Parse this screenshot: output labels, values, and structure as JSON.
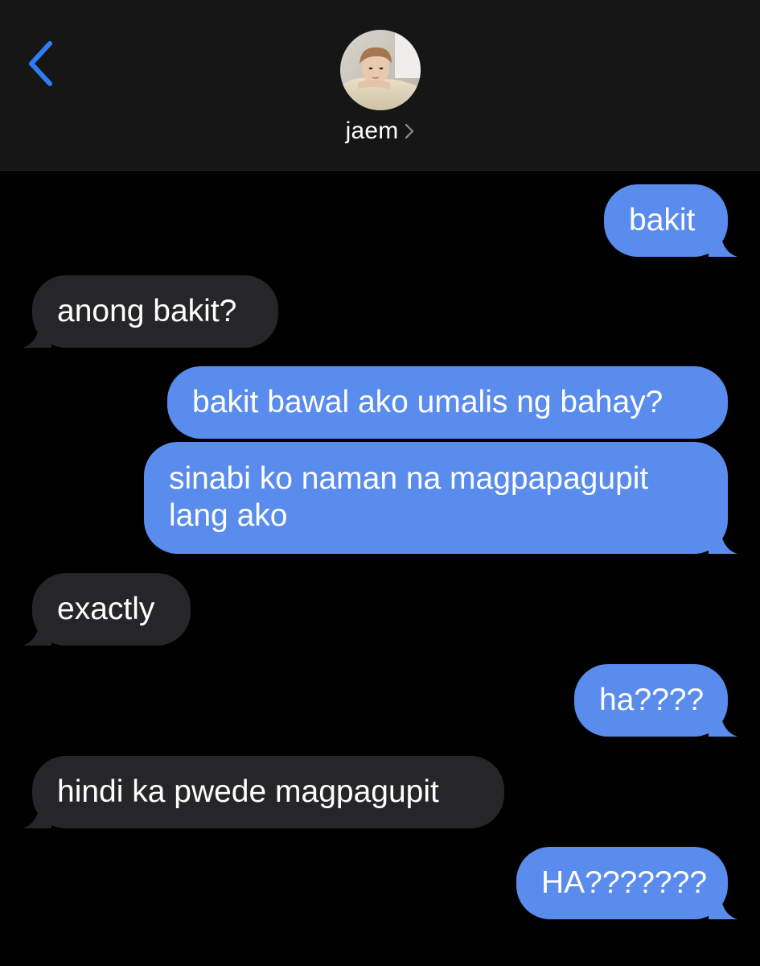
{
  "header": {
    "back_label": "Back",
    "contact_name": "jaem",
    "colors": {
      "accent": "#2f7cf6",
      "header_bg": "#161616"
    }
  },
  "messages": [
    {
      "side": "sent",
      "text": "bakit"
    },
    {
      "side": "received",
      "text": "anong bakit?"
    },
    {
      "side": "sent",
      "text": "bakit bawal ako umalis ng bahay?"
    },
    {
      "side": "sent",
      "text": "sinabi ko naman na magpapagupit lang ako"
    },
    {
      "side": "received",
      "text": "exactly"
    },
    {
      "side": "sent",
      "text": "ha????"
    },
    {
      "side": "received",
      "text": "hindi ka pwede magpagupit"
    },
    {
      "side": "sent",
      "text": "HA???????"
    }
  ],
  "colors": {
    "sent_bubble": "#5a8ced",
    "received_bubble": "#262628",
    "background": "#000000"
  },
  "icons": [
    "chevron-left-icon",
    "chevron-right-icon",
    "avatar"
  ]
}
